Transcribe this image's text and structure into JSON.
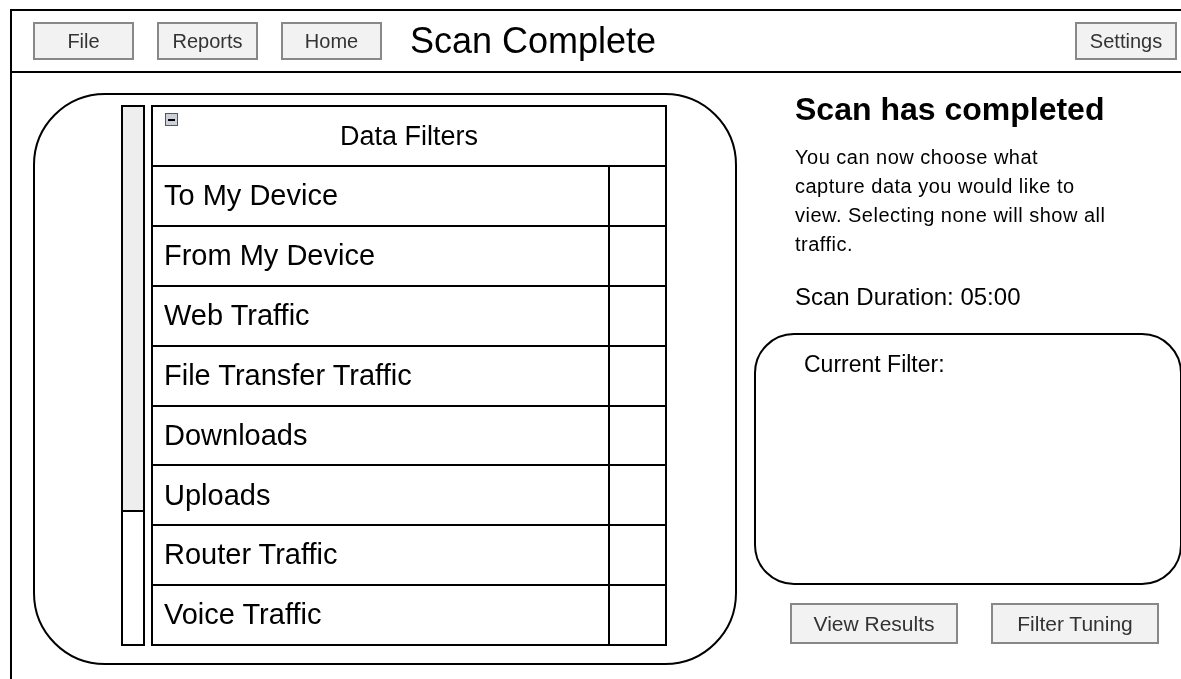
{
  "toolbar": {
    "buttons": [
      "File",
      "Reports",
      "Home"
    ],
    "title": "Scan Complete",
    "settings": "Settings"
  },
  "filters": {
    "title": "Data Filters",
    "rows": [
      {
        "label": "To My Device"
      },
      {
        "label": "From My Device"
      },
      {
        "label": "Web Traffic"
      },
      {
        "label": "File Transfer Traffic"
      },
      {
        "label": "Downloads"
      },
      {
        "label": "Uploads"
      },
      {
        "label": "Router Traffic"
      },
      {
        "label": "Voice Traffic"
      }
    ]
  },
  "info": {
    "heading": "Scan has completed",
    "description": "You can now choose what capture data you would like to view. Selecting none will show all traffic.",
    "duration": "Scan Duration: 05:00",
    "current_filter_label": "Current Filter:"
  },
  "actions": [
    "View Results",
    "Filter Tuning"
  ]
}
